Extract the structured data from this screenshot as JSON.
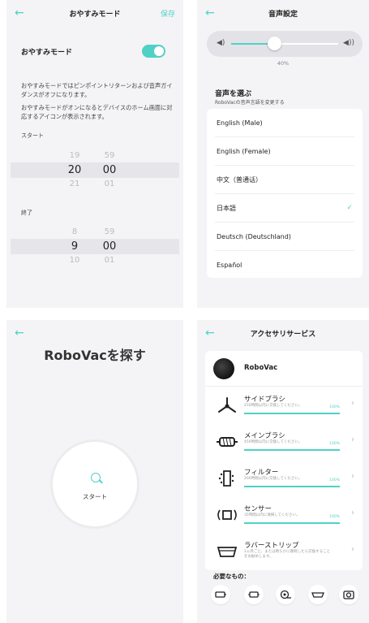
{
  "dnd": {
    "title": "おやすみモード",
    "save": "保存",
    "label": "おやすみモード",
    "enabled": true,
    "desc1": "おやすみモードではピンポイントリターンおよび音声ガイダンスがオフになります。",
    "desc2": "おやすみモードがオンになるとデバイスのホーム画面に対応するアイコンが表示されます。",
    "start_label": "スタート",
    "start": {
      "h_prev": "19",
      "h": "20",
      "h_next": "21",
      "m_prev": "59",
      "m": "00",
      "m_next": "01"
    },
    "end_label": "終了",
    "end": {
      "h_prev": "8",
      "h": "9",
      "h_next": "10",
      "m_prev": "59",
      "m": "00",
      "m_next": "01"
    }
  },
  "voice": {
    "title": "音声設定",
    "volume_pct": "40%",
    "volume_value": 0.4,
    "choose": "音声を選ぶ",
    "choose_sub": "RoboVacの音声言語を変更する",
    "languages": [
      {
        "label": "English (Male)",
        "selected": false
      },
      {
        "label": "English (Female)",
        "selected": false
      },
      {
        "label": "中文（普通话）",
        "selected": false
      },
      {
        "label": "日本語",
        "selected": true
      },
      {
        "label": "Deutsch (Deutschland)",
        "selected": false
      },
      {
        "label": "Español",
        "selected": false
      }
    ],
    "check": "✓"
  },
  "find": {
    "title": "RoboVacを探す",
    "start": "スタート"
  },
  "accessories": {
    "title": "アクセサリサービス",
    "device": "RoboVac",
    "items": [
      {
        "name": "サイドブラシ",
        "sub": "250時間以内に交換してください。",
        "pct": "100%",
        "value": 1.0,
        "icon": "side-brush-icon"
      },
      {
        "name": "メインブラシ",
        "sub": "450時間以内に交換してください。",
        "pct": "100%",
        "value": 1.0,
        "icon": "main-brush-icon"
      },
      {
        "name": "フィルター",
        "sub": "200時間以内に交換してください。",
        "pct": "100%",
        "value": 1.0,
        "icon": "filter-icon"
      },
      {
        "name": "センサー",
        "sub": "35時間以内に清掃してください。",
        "pct": "100%",
        "value": 1.0,
        "icon": "sensor-icon"
      },
      {
        "name": "ラバーストリップ",
        "sub": "2ヵ月ごと、または明らかに摩耗したら交換することをお勧めします。",
        "pct": "",
        "value": null,
        "icon": "rubber-strip-icon"
      }
    ],
    "needs": "必要なもの："
  },
  "colors": {
    "accent": "#4fd1c5",
    "panel_bg": "#f4f4f6"
  }
}
